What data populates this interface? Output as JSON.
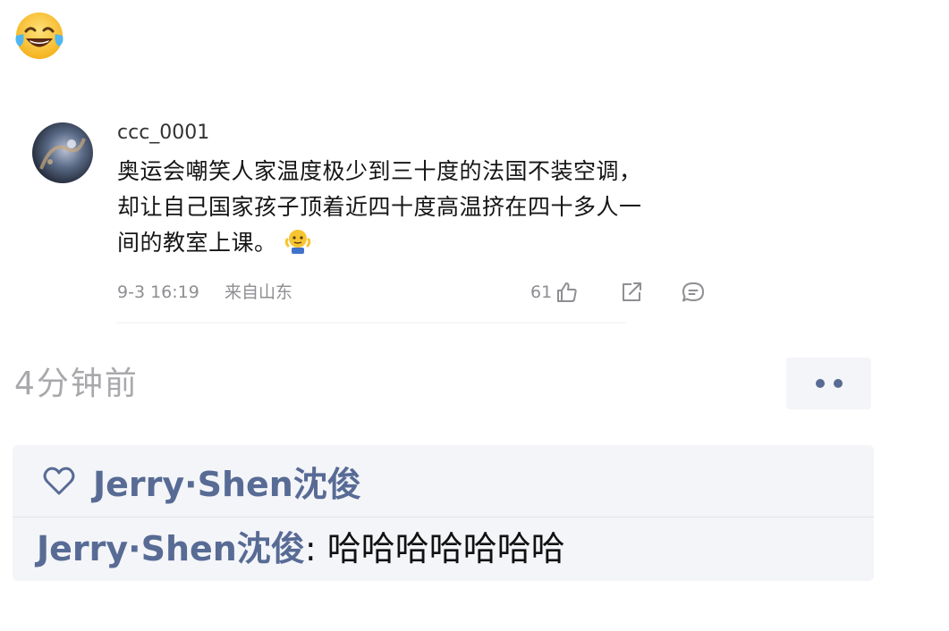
{
  "top_emoji": "tears-of-joy-emoji",
  "comment": {
    "username": "ccc_0001",
    "text_lines": [
      "奥运会嘲笑人家温度极少到三十度的法国不装空调，",
      "却让自己国家孩子顶着近四十度高温挤在四十多人一",
      "间的教室上课。"
    ],
    "inline_emoji": "shrug-emoji",
    "time": "9-3 16:19",
    "location": "来自山东",
    "like_count": "61",
    "icons": {
      "like": "thumbs-up-icon",
      "share": "share-icon",
      "reply": "comment-icon"
    }
  },
  "moment": {
    "time_ago": "4分钟前",
    "more_button": "more-options-icon",
    "likes": {
      "icon": "heart-icon",
      "users": "Jerry·Shen沈俊"
    },
    "reply": {
      "name": "Jerry·Shen沈俊",
      "separator": ": ",
      "text": "哈哈哈哈哈哈哈"
    }
  },
  "colors": {
    "link_blue": "#576b95",
    "box_bg": "#f4f5f8",
    "meta_gray": "#8e8e93",
    "time_gray": "#a9a9ad"
  }
}
